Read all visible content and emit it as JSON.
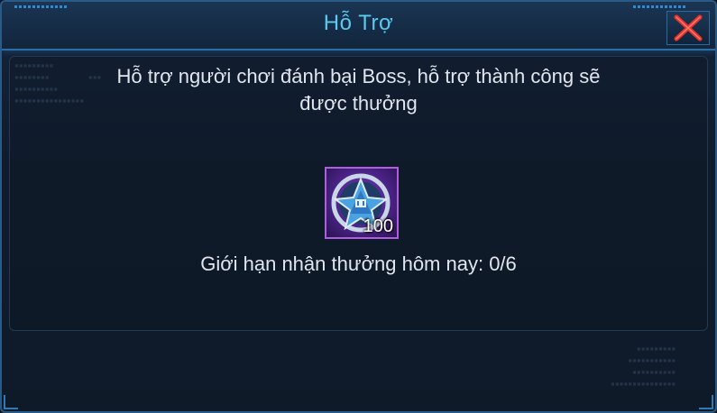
{
  "dialog": {
    "title": "Hỗ Trợ",
    "close_icon": "close-x-icon",
    "description_line1": "Hỗ trợ người chơi đánh bại Boss, hỗ trợ thành công sẽ",
    "description_line2": "được thưởng",
    "reward": {
      "icon": "pentagram-medal-icon",
      "quantity": "100"
    },
    "limit_text": "Giới hạn nhận thưởng hôm nay: 0/6"
  },
  "colors": {
    "title": "#5cc9ef",
    "text": "#dfe6ee",
    "close_x": "#e8332b",
    "reward_border": "#b05ee0",
    "frame": "#2a5a86"
  }
}
